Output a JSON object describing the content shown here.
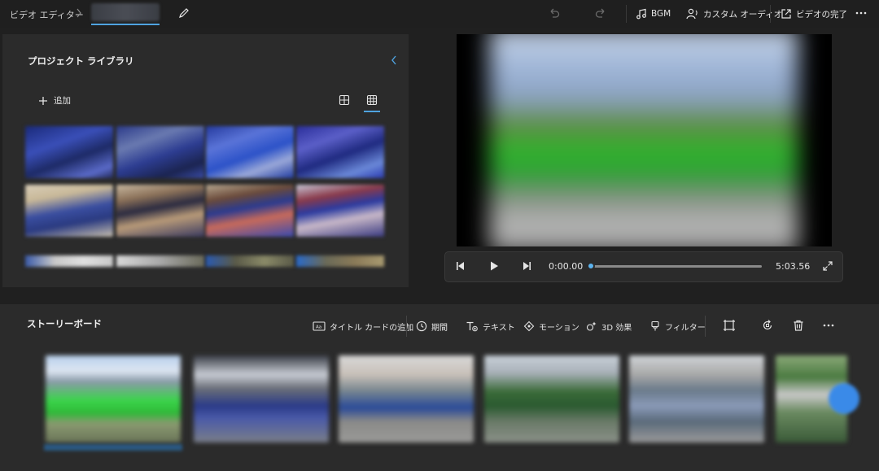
{
  "topbar": {
    "app_name": "ビデオ エディター",
    "undo_icon": "undo-icon",
    "redo_icon": "redo-icon",
    "bgm_label": "BGM",
    "custom_audio_label": "カスタム オーディオ",
    "finish_video_label": "ビデオの完了"
  },
  "library": {
    "title": "プロジェクト ライブラリ",
    "add_label": "追加"
  },
  "player": {
    "current_time": "0:00.00",
    "total_time": "5:03.56",
    "progress": 0.0
  },
  "storyboard": {
    "title": "ストーリーボード",
    "tools": {
      "title_card": "タイトル カードの追加",
      "duration": "期間",
      "text": "テキスト",
      "motion": "モーション",
      "effects_3d": "3D 効果",
      "filters": "フィルター"
    }
  },
  "colors": {
    "accent": "#4fa3e0",
    "background": "#202020",
    "panel": "#2b2b2b"
  }
}
